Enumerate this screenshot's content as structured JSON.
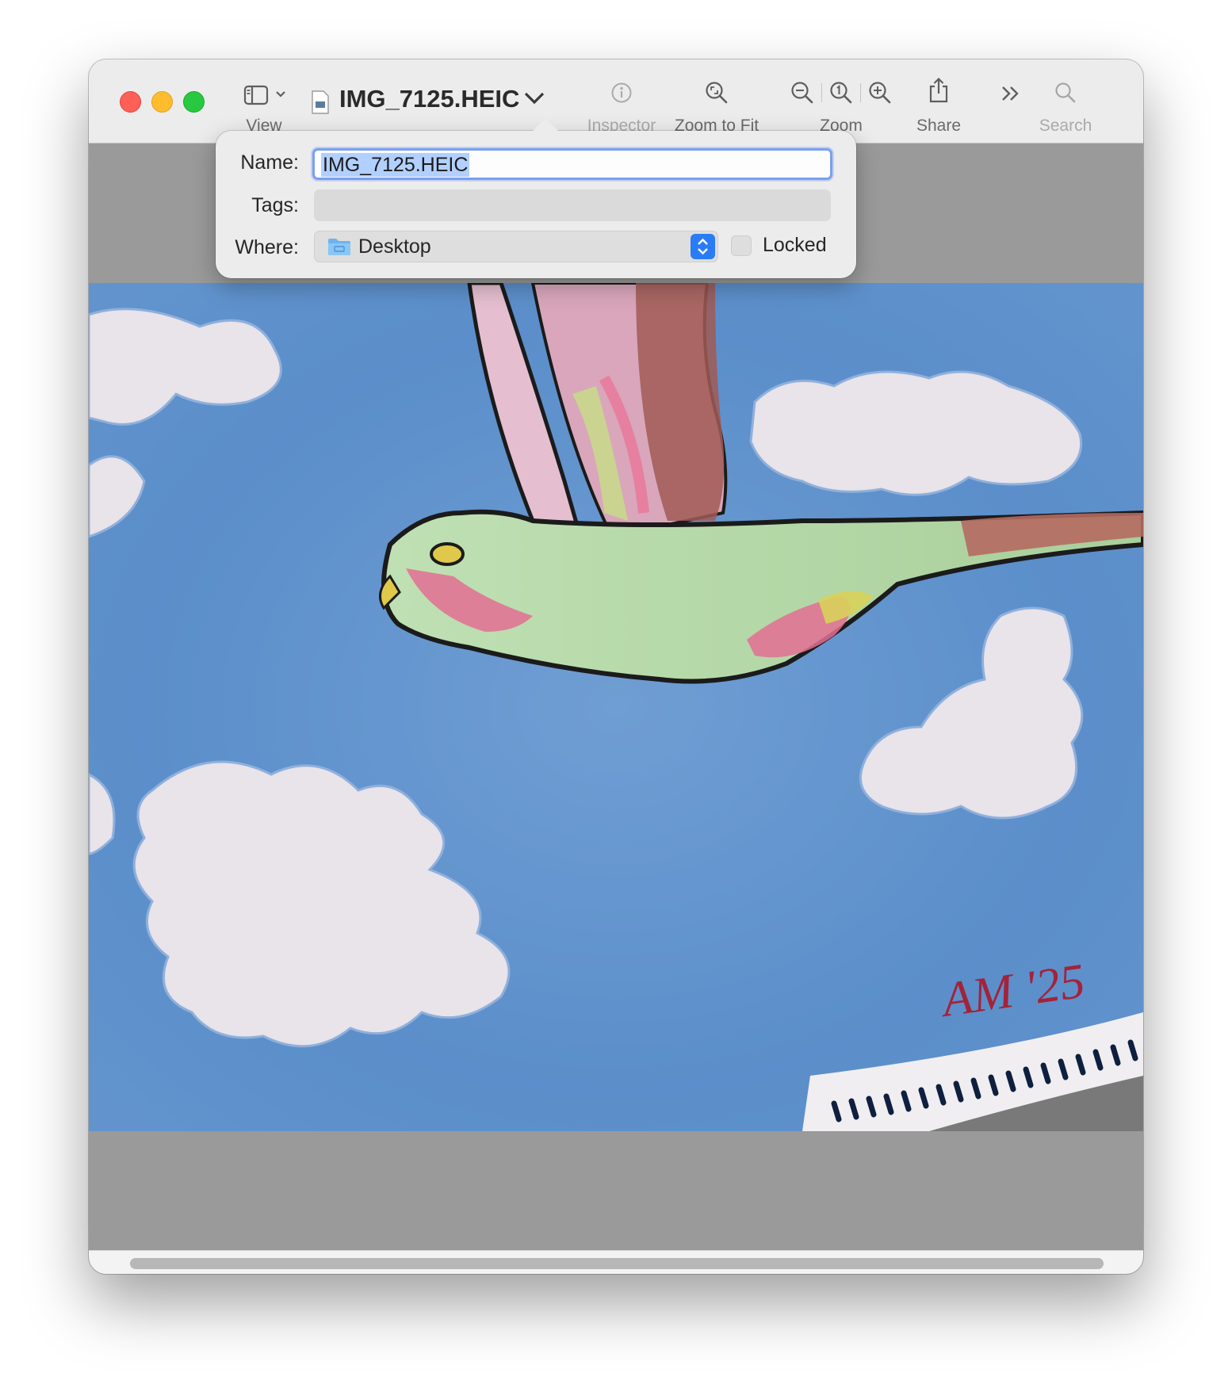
{
  "window": {
    "title": "IMG_7125.HEIC"
  },
  "toolbar": {
    "view_label": "View",
    "inspector_label": "Inspector",
    "zoom_to_fit_label": "Zoom to Fit",
    "zoom_label": "Zoom",
    "share_label": "Share",
    "search_label": "Search"
  },
  "rename_popover": {
    "name_label": "Name:",
    "name_value": "IMG_7125.HEIC",
    "tags_label": "Tags:",
    "tags_value": "",
    "where_label": "Where:",
    "where_value": "Desktop",
    "locked_label": "Locked",
    "locked_checked": false
  },
  "image": {
    "signature_text": "AM '25"
  },
  "icons": [
    "sidebar-toggle-icon",
    "chevron-down-icon",
    "document-icon",
    "info-icon",
    "zoom-to-fit-icon",
    "zoom-out-icon",
    "actual-size-icon",
    "zoom-in-icon",
    "share-icon",
    "more-chevron-icon",
    "search-icon",
    "folder-icon",
    "stepper-icon"
  ],
  "colors": {
    "accent_blue": "#2a7cf6",
    "selection": "#b2d0ff",
    "close": "#fe5f57",
    "minimize": "#febc2e",
    "zoom": "#28c840"
  }
}
